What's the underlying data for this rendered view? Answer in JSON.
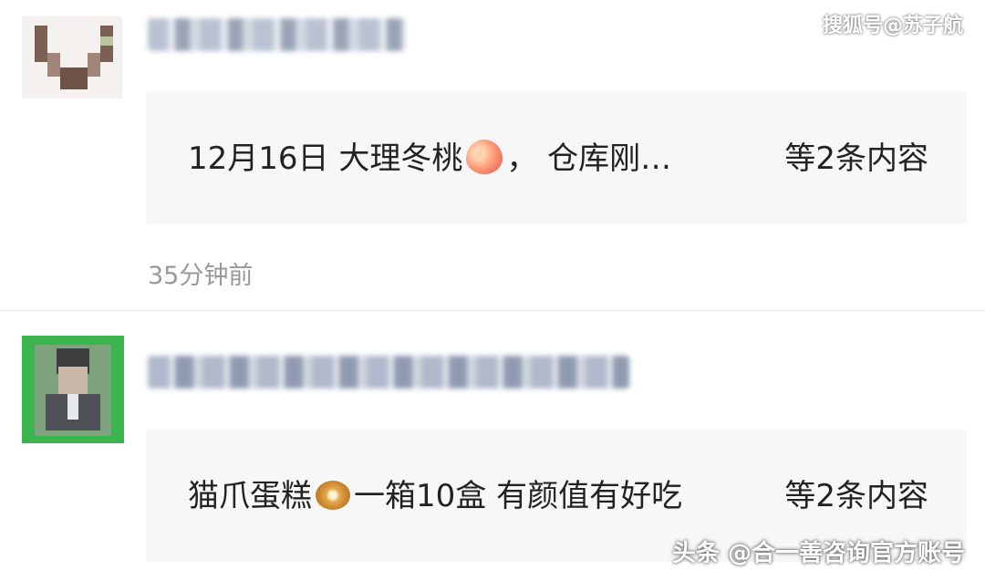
{
  "watermark_top": "搜狐号@苏子航",
  "watermark_bottom": "头条 @合一善咨询官方账号",
  "posts": [
    {
      "avatar": "blurred-avatar",
      "name_blurred": true,
      "text_before_emoji": "12月16日 大理冬桃",
      "emoji": "peach-emoji",
      "text_after_emoji": "， 仓库刚…",
      "more": "等2条内容",
      "time": "35分钟前"
    },
    {
      "avatar": "blurred-avatar",
      "name_blurred": true,
      "text_before_emoji": "猫爪蛋糕",
      "emoji": "snail-emoji",
      "text_after_emoji": "一箱10盒 有颜值有好吃",
      "more": "等2条内容"
    }
  ],
  "colors": {
    "card_bg": "#f7f7f8",
    "text": "#222222",
    "time": "#999999"
  }
}
